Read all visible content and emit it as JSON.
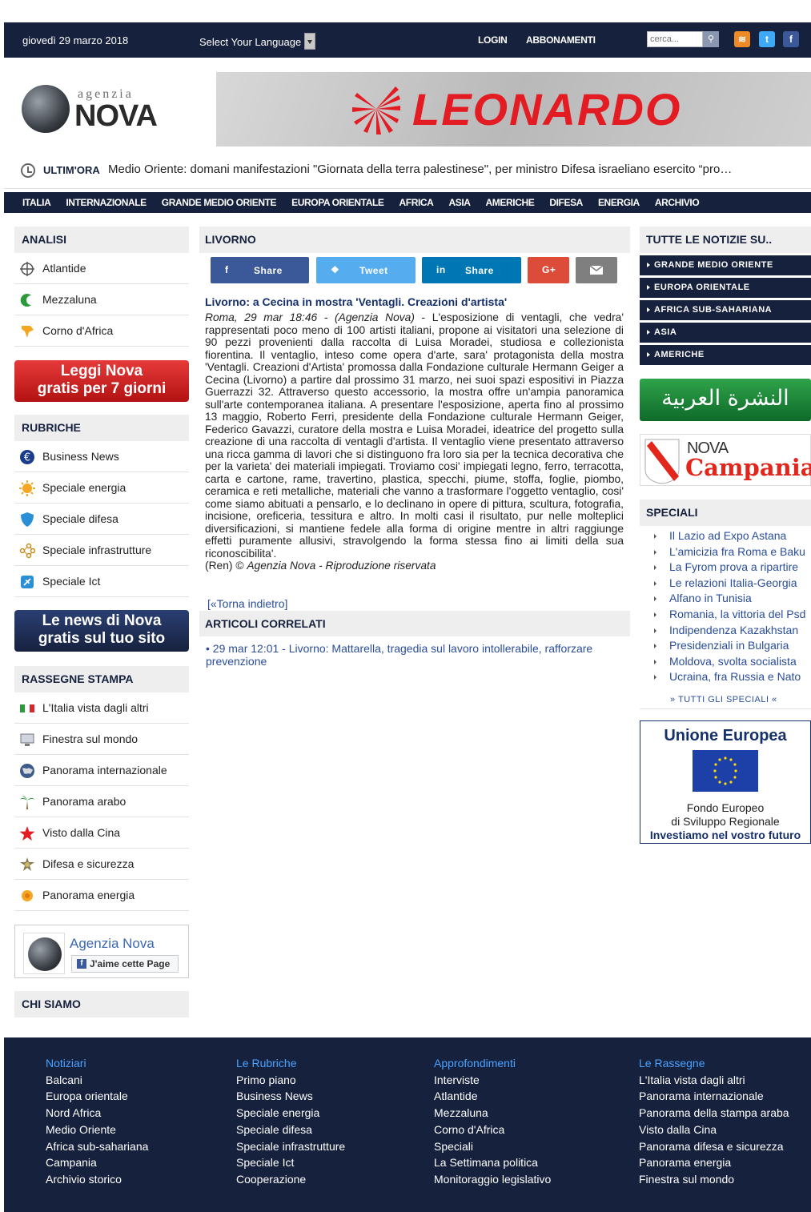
{
  "topbar": {
    "date": "giovedì 29 marzo 2018",
    "language_label": "Select Your Language",
    "login": "LOGIN",
    "abbonamenti": "ABBONAMENTI",
    "search_placeholder": "cerca...",
    "icons": [
      "rss-icon",
      "twitter-icon",
      "facebook-icon"
    ]
  },
  "logo": {
    "top": "agenzia",
    "main": "NOVA"
  },
  "banner": {
    "text": "LEONARDO"
  },
  "ticker": {
    "label": "ULTIM'ORA",
    "text": "Medio Oriente: domani manifestazioni \"Giornata della terra palestinese\", per ministro Difesa israeliano esercito “pro…"
  },
  "nav": [
    "ITALIA",
    "INTERNAZIONALE",
    "GRANDE MEDIO ORIENTE",
    "EUROPA ORIENTALE",
    "AFRICA",
    "ASIA",
    "AMERICHE",
    "DIFESA",
    "ENERGIA",
    "ARCHIVIO"
  ],
  "left": {
    "analisi_title": "ANALISI",
    "analisi": [
      "Atlantide",
      "Mezzaluna",
      "Corno d'Africa"
    ],
    "promo1": {
      "line1": "Leggi Nova",
      "line2": "gratis per 7 giorni"
    },
    "rubriche_title": "RUBRICHE",
    "rubriche": [
      "Business News",
      "Speciale energia",
      "Speciale difesa",
      "Speciale infrastrutture",
      "Speciale Ict"
    ],
    "promo2": {
      "line1": "Le news di Nova",
      "line2": "gratis sul tuo sito"
    },
    "rassegne_title": "RASSEGNE STAMPA",
    "rassegne": [
      "L'Italia vista dagli altri",
      "Finestra sul mondo",
      "Panorama internazionale",
      "Panorama arabo",
      "Visto dalla Cina",
      "Difesa e sicurezza",
      "Panorama energia"
    ],
    "fb_widget": {
      "name": "Agenzia Nova",
      "like": "J'aime cette Page"
    },
    "chi_siamo": "CHI SIAMO"
  },
  "center": {
    "section_title": "LIVORNO",
    "share": [
      {
        "icon": "f",
        "label": "Share",
        "color": "#3b5998"
      },
      {
        "icon": "t",
        "label": "Tweet",
        "color": "#55acee"
      },
      {
        "icon": "in",
        "label": "Share",
        "color": "#0077b5"
      },
      {
        "icon": "G+",
        "label": "",
        "color": "#dd4b39"
      },
      {
        "icon": "mail",
        "label": "",
        "color": "#7f7f7f"
      }
    ],
    "article_title": "Livorno: a Cecina in mostra 'Ventagli. Creazioni d'artista'",
    "dateline": "Roma, 29 mar 18:46 - (Agenzia Nova)",
    "body": " - L'esposizione di ventagli, che vedra' rappresentati poco meno di 100 artisti italiani, propone ai visitatori una selezione di 90 pezzi provenienti dalla raccolta di Luisa Moradei, studiosa e collezionista fiorentina. Il ventaglio, inteso come opera d'arte, sara' protagonista della mostra 'Ventagli. Creazioni d'Artista' promossa dalla Fondazione culturale Hermann Geiger a Cecina (Livorno) a partire dal prossimo 31 marzo, nei suoi spazi espositivi in Piazza Guerrazzi 32. Attraverso questo accessorio, la mostra offre un'ampia panoramica sull'arte contemporanea italiana. A presentare l'esposizione, aperta fino al prossimo 13 maggio, Roberto Ferri, presidente della Fondazione culturale Hermann Geiger, Federico Gavazzi, curatore della mostra e Luisa Moradei, ideatrice del progetto sulla creazione di una raccolta di ventagli d'artista. Il ventaglio viene presentato attraverso una ricca gamma di lavori che si distinguono fra loro sia per la tecnica decorativa che per la varieta' dei materiali impiegati. Troviamo cosi' impiegati legno, ferro, terracotta, carta e cartone, rame, travertino, plastica, specchi, piume, stoffa, foglie, piombo, ceramica e reti metalliche, materiali che vanno a trasformare l'oggetto ventaglio, cosi' come siamo abituati a pensarlo, e lo declinano in opere di pittura, scultura, fotografia, incisione, oreficeria, tessitura e altro. In molti casi il risultato, pur nelle molteplici diversificazioni, si mantiene fedele alla forma di origine mentre in altri raggiunge effetti puramente allusivi, stravolgendo la forma stessa fino ai limiti della sua riconoscibilita'.",
    "credit_prefix": "(Ren) © ",
    "credit": "Agenzia Nova - Riproduzione riservata",
    "back_link": "[«Torna indietro]",
    "related_title": "ARTICOLI CORRELATI",
    "related": [
      "• 29 mar 12:01 - Livorno: Mattarella, tragedia sul lavoro intollerabile, rafforzare prevenzione"
    ]
  },
  "right": {
    "title": "TUTTE LE NOTIZIE SU..",
    "regions": [
      "GRANDE MEDIO ORIENTE",
      "EUROPA ORIENTALE",
      "AFRICA SUB-SAHARIANA",
      "ASIA",
      "AMERICHE"
    ],
    "arabic_banner": "النشرة العربية",
    "campania": {
      "top": "NOVA",
      "main": "Campania"
    },
    "speciali_title": "SPECIALI",
    "speciali": [
      "Il Lazio ad Expo Astana",
      "L'amicizia fra Roma e Baku",
      "La Fyrom prova a ripartire",
      "Le relazioni Italia-Georgia",
      "Alfano in Tunisia",
      "Romania, la vittoria del Psd",
      "Indipendenza Kazakhstan",
      "Presidenziali in Bulgaria",
      "Moldova, svolta socialista",
      "Ucraina, fra Russia e Nato"
    ],
    "tutti": "» TUTTI GLI SPECIALI «",
    "eu": {
      "title": "Unione Europea",
      "line1": "Fondo Europeo",
      "line2": "di Sviluppo Regionale",
      "line3": "Investiamo nel vostro futuro"
    }
  },
  "footer": {
    "columns": [
      {
        "title": "Notiziari",
        "items": [
          "Balcani",
          "Europa orientale",
          "Nord Africa",
          "Medio Oriente",
          "Africa sub-sahariana",
          "Campania",
          "Archivio storico"
        ]
      },
      {
        "title": "Le Rubriche",
        "items": [
          "Primo piano",
          "Business News",
          "Speciale energia",
          "Speciale difesa",
          "Speciale infrastrutture",
          "Speciale Ict",
          "Cooperazione"
        ]
      },
      {
        "title": "Approfondimenti",
        "items": [
          "Interviste",
          "Atlantide",
          "Mezzaluna",
          "Corno d'Africa",
          "Speciali",
          "La Settimana politica",
          "Monitoraggio legislativo"
        ]
      },
      {
        "title": "Le Rassegne",
        "items": [
          "L'Italia vista dagli altri",
          "Panorama internazionale",
          "Panorama della stampa araba",
          "Visto dalla Cina",
          "Panorama difesa e sicurezza",
          "Panorama energia",
          "Finestra sul mondo"
        ]
      }
    ]
  }
}
